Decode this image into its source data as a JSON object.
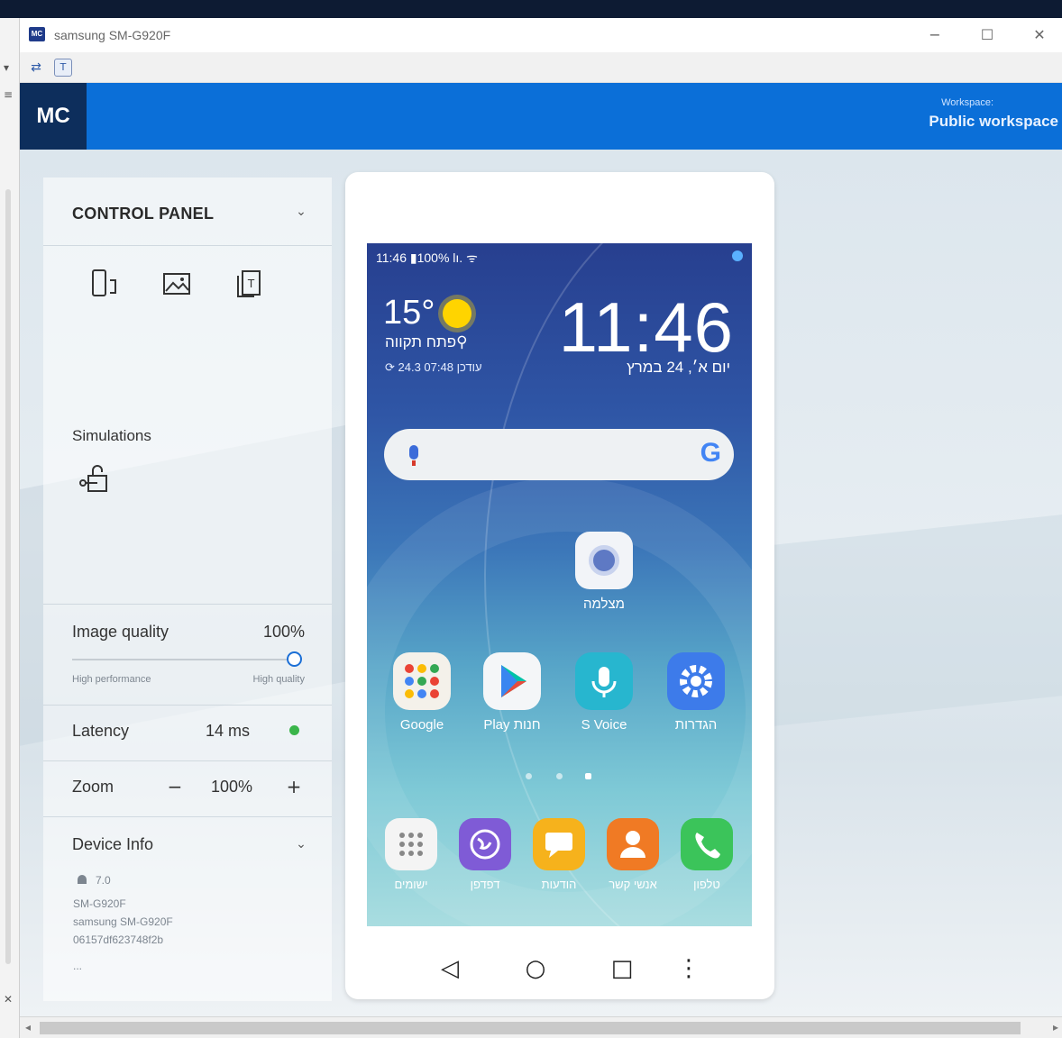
{
  "window": {
    "app_icon_text": "MC",
    "title": "samsung SM-G920F",
    "minimize_icon": "−",
    "maximize_icon": "☐",
    "close_icon": "✕"
  },
  "toolbar": {
    "refresh_icon": "⇄",
    "text_icon": "T"
  },
  "header": {
    "logo": "MC",
    "workspace_label": "Workspace:",
    "workspace_name": "Public workspace"
  },
  "control_panel": {
    "title": "CONTROL PANEL",
    "collapse_icon": "⌄",
    "simulations_label": "Simulations",
    "image_quality": {
      "label": "Image quality",
      "value": "100%",
      "slider_fraction": 1.0,
      "min_caption": "High performance",
      "max_caption": "High quality"
    },
    "latency": {
      "label": "Latency",
      "value": "14 ms",
      "status_color": "#3ab54a"
    },
    "zoom": {
      "label": "Zoom",
      "minus": "−",
      "value": "100%",
      "plus": "+"
    },
    "device_info": {
      "label": "Device Info",
      "os_version": "7.0",
      "model": "SM-G920F",
      "name": "samsung SM-G920F",
      "serial": "06157df623748f2b",
      "more": "..."
    }
  },
  "phone": {
    "status_bar": "11:46 ▮100% lı. ᯤ",
    "weather": {
      "temperature": "15°",
      "city": "פתח תקווה⚲",
      "updated": "⟳ 24.3 07:48 עודכן"
    },
    "clock": "11:46",
    "date": "יום א׳, 24 במרץ",
    "search_g": "G",
    "camera_label": "מצלמה",
    "apps_row": [
      {
        "label": "Google",
        "color": "#f4f1ea"
      },
      {
        "label": "Play חנות",
        "color": "#f4f6f8"
      },
      {
        "label": "S Voice",
        "color": "#27b6cf"
      },
      {
        "label": "הגדרות",
        "color": "#3d7bea"
      }
    ],
    "dock": [
      {
        "label": "ישומים",
        "color": "#f4f4f4"
      },
      {
        "label": "דפדפן",
        "color": "#7f5bd6"
      },
      {
        "label": "הודעות",
        "color": "#f6b21c"
      },
      {
        "label": "אנשי קשר",
        "color": "#f07a24"
      },
      {
        "label": "טלפון",
        "color": "#3bc45a"
      }
    ],
    "nav": {
      "back": "◁",
      "home": "○",
      "recents": "□",
      "menu": "⋮"
    }
  }
}
